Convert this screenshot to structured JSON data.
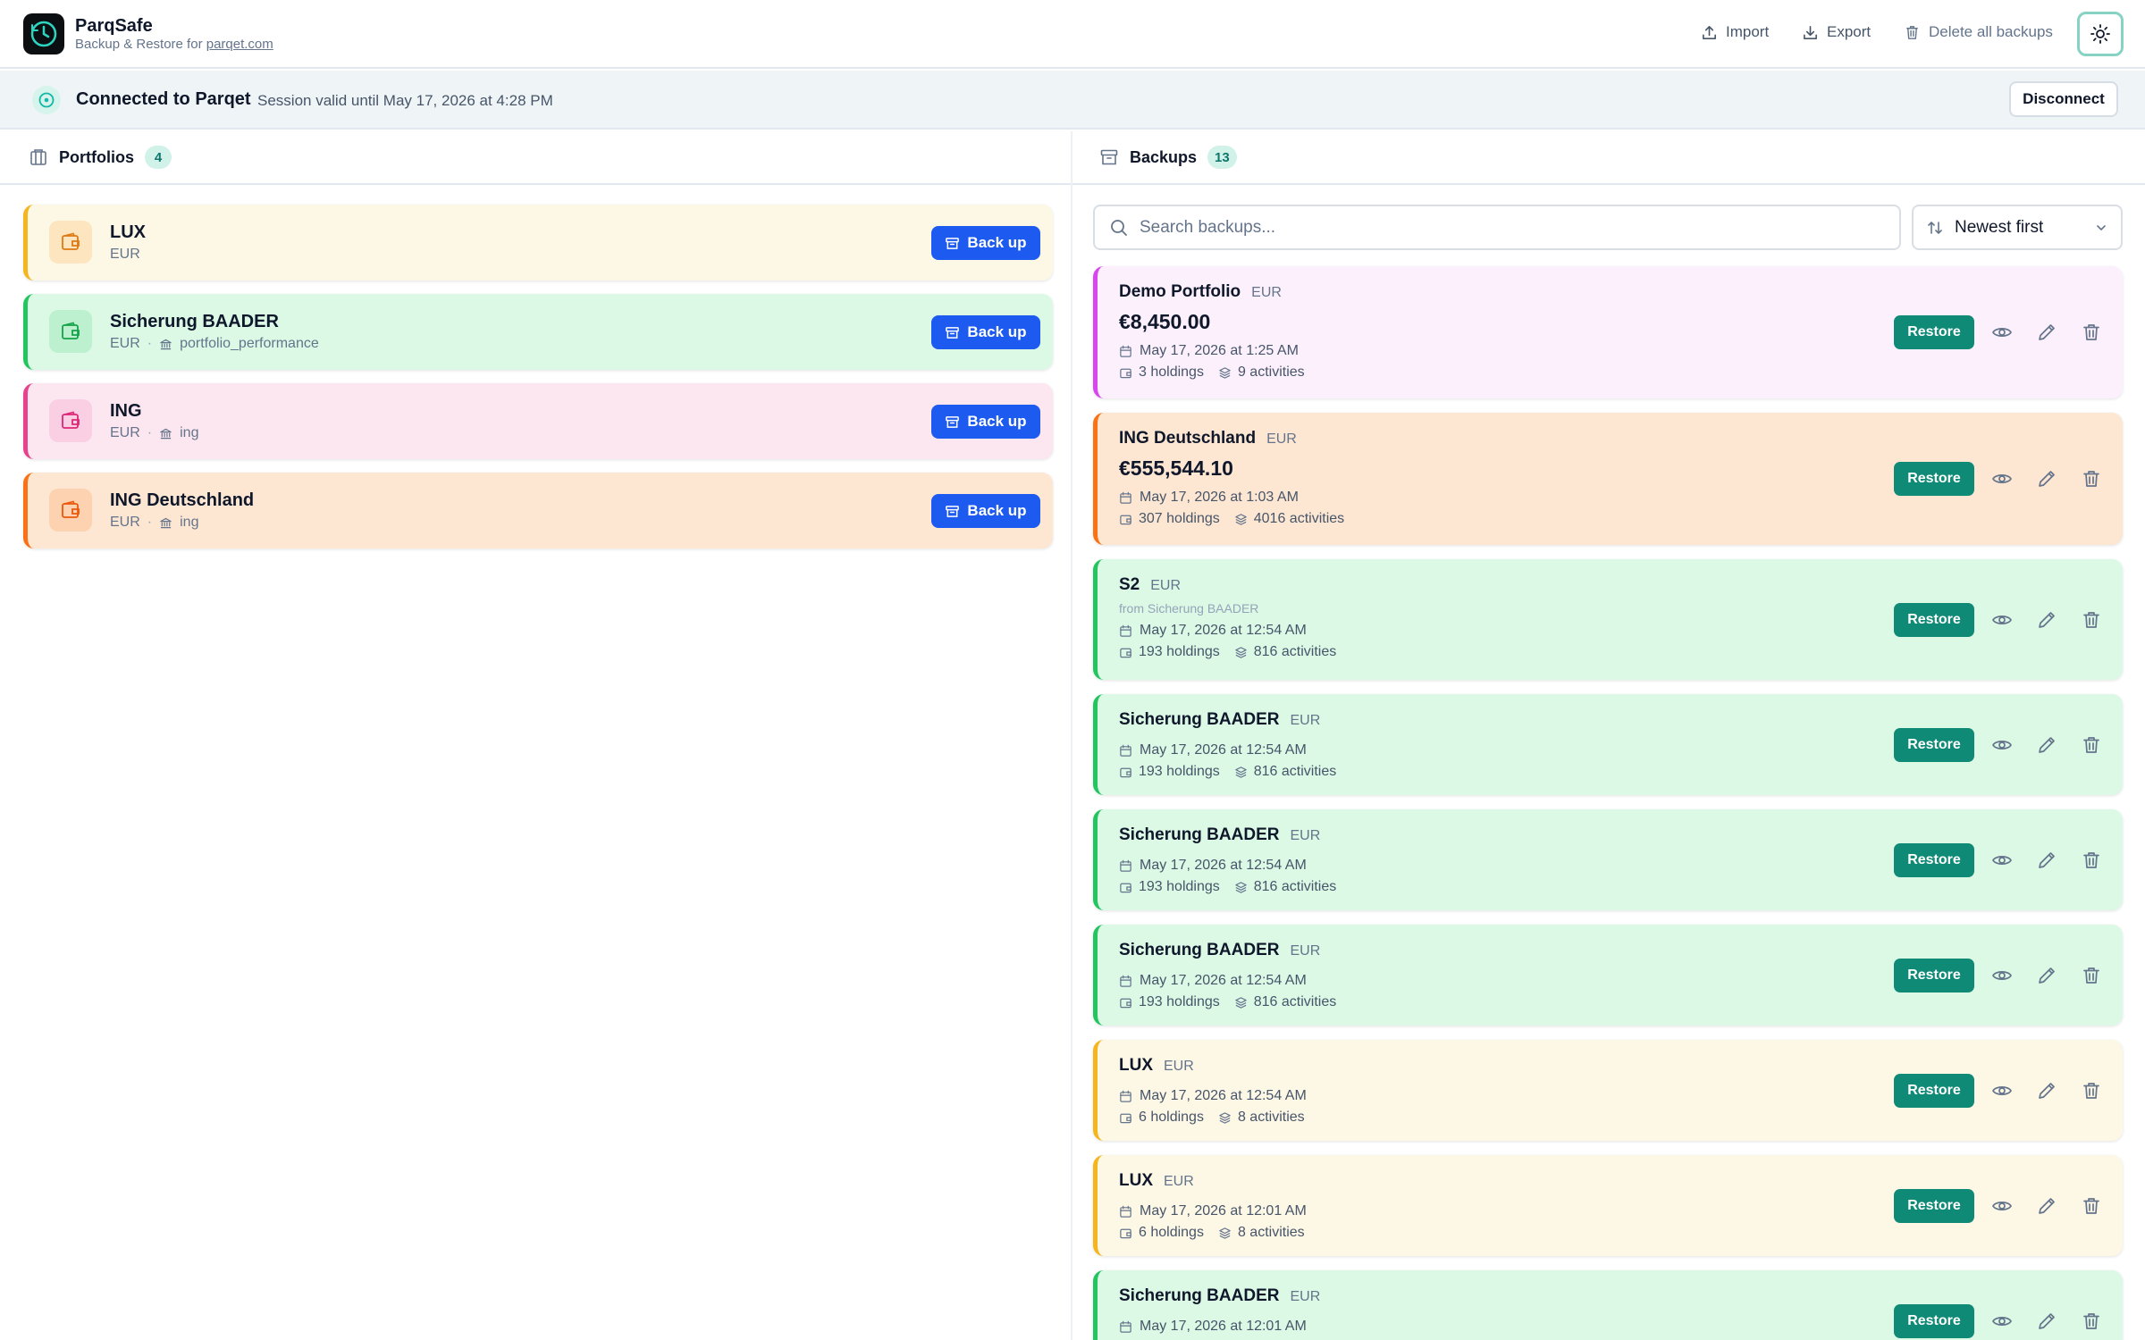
{
  "app": {
    "name": "ParqSafe",
    "subtitle_prefix": "Backup & Restore for ",
    "subtitle_link": "parqet.com"
  },
  "toolbar": {
    "import_label": "Import",
    "export_label": "Export",
    "delete_all_label": "Delete all backups"
  },
  "connection": {
    "title": "Connected to Parqet",
    "session": "Session valid until May 17, 2026 at 4:28 PM",
    "disconnect_label": "Disconnect"
  },
  "portfolios": {
    "heading": "Portfolios",
    "count": "4",
    "backup_label": "Back up",
    "items": [
      {
        "name": "LUX",
        "currency": "EUR",
        "source": "",
        "accent": "#f5b51d",
        "bg": "#fdf7e6",
        "iconbg": "#fde6bf",
        "iconfg": "#dd7a14"
      },
      {
        "name": "Sicherung BAADER",
        "currency": "EUR",
        "source": "portfolio_performance",
        "accent": "#22c55e",
        "bg": "#dcf9e6",
        "iconbg": "#bdf0cf",
        "iconfg": "#16a34a"
      },
      {
        "name": "ING",
        "currency": "EUR",
        "source": "ing",
        "accent": "#e7428c",
        "bg": "#fce6f0",
        "iconbg": "#fbcfe3",
        "iconfg": "#db2777"
      },
      {
        "name": "ING Deutschland",
        "currency": "EUR",
        "source": "ing",
        "accent": "#f97316",
        "bg": "#fde7d3",
        "iconbg": "#fdd2b0",
        "iconfg": "#ea580c"
      }
    ]
  },
  "backups": {
    "heading": "Backups",
    "count": "13",
    "search_placeholder": "Search backups...",
    "sort_label": "Newest first",
    "restore_label": "Restore",
    "items": [
      {
        "name": "Demo Portfolio",
        "currency": "EUR",
        "value": "€8,450.00",
        "from": "",
        "date": "May 17, 2026 at 1:25 AM",
        "holdings": "3 holdings",
        "activities": "9 activities",
        "accent": "#d946ef",
        "bg": "#fdf0fd"
      },
      {
        "name": "ING Deutschland",
        "currency": "EUR",
        "value": "€555,544.10",
        "from": "",
        "date": "May 17, 2026 at 1:03 AM",
        "holdings": "307 holdings",
        "activities": "4016 activities",
        "accent": "#f97316",
        "bg": "#fde7d3"
      },
      {
        "name": "S2",
        "currency": "EUR",
        "value": "",
        "from": "from Sicherung BAADER",
        "date": "May 17, 2026 at 12:54 AM",
        "holdings": "193 holdings",
        "activities": "816 activities",
        "accent": "#22c55e",
        "bg": "#dcf9e6"
      },
      {
        "name": "Sicherung BAADER",
        "currency": "EUR",
        "value": "",
        "from": "",
        "date": "May 17, 2026 at 12:54 AM",
        "holdings": "193 holdings",
        "activities": "816 activities",
        "accent": "#22c55e",
        "bg": "#dcf9e6"
      },
      {
        "name": "Sicherung BAADER",
        "currency": "EUR",
        "value": "",
        "from": "",
        "date": "May 17, 2026 at 12:54 AM",
        "holdings": "193 holdings",
        "activities": "816 activities",
        "accent": "#22c55e",
        "bg": "#dcf9e6"
      },
      {
        "name": "Sicherung BAADER",
        "currency": "EUR",
        "value": "",
        "from": "",
        "date": "May 17, 2026 at 12:54 AM",
        "holdings": "193 holdings",
        "activities": "816 activities",
        "accent": "#22c55e",
        "bg": "#dcf9e6"
      },
      {
        "name": "LUX",
        "currency": "EUR",
        "value": "",
        "from": "",
        "date": "May 17, 2026 at 12:54 AM",
        "holdings": "6 holdings",
        "activities": "8 activities",
        "accent": "#f5b51d",
        "bg": "#fdf7e6"
      },
      {
        "name": "LUX",
        "currency": "EUR",
        "value": "",
        "from": "",
        "date": "May 17, 2026 at 12:01 AM",
        "holdings": "6 holdings",
        "activities": "8 activities",
        "accent": "#f5b51d",
        "bg": "#fdf7e6"
      },
      {
        "name": "Sicherung BAADER",
        "currency": "EUR",
        "value": "",
        "from": "",
        "date": "May 17, 2026 at 12:01 AM",
        "holdings": "",
        "activities": "",
        "accent": "#22c55e",
        "bg": "#dcf9e6"
      }
    ]
  }
}
